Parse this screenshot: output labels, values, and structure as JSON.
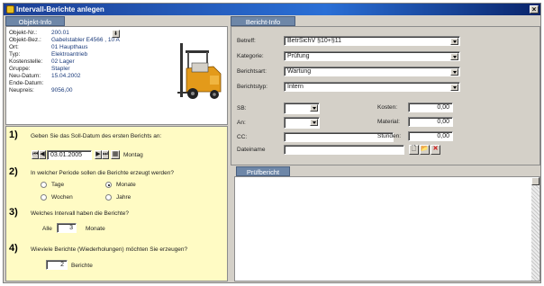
{
  "window": {
    "title": "Intervall-Berichte anlegen",
    "close_label": "×"
  },
  "tabs": {
    "objekt": "Objekt-Info",
    "bericht": "Bericht-Info",
    "pruef": "Prüfbericht"
  },
  "objekt": {
    "rows": [
      {
        "label": "Objekt-Nr.:",
        "value": "200.01"
      },
      {
        "label": "Objekt-Bez.:",
        "value": "Gabelstabler E4566 , 10 A"
      },
      {
        "label": "Ort:",
        "value": "01 Haupthaus"
      },
      {
        "label": "Typ:",
        "value": "Elektroantrieb"
      },
      {
        "label": "Kostenstelle:",
        "value": "02 Lager"
      },
      {
        "label": "Gruppe:",
        "value": "Stapler"
      },
      {
        "label": "Neu-Datum:",
        "value": "15.04.2002"
      },
      {
        "label": "Ende-Datum:",
        "value": ""
      },
      {
        "label": "Neupreis:",
        "value": "9056,00"
      }
    ],
    "image_desc": "forklift-image"
  },
  "wizard": {
    "q1": {
      "num": "1)",
      "text": "Geben Sie das Soll-Datum des ersten Berichts an:",
      "date": "03.01.2005",
      "weekday": "Montag"
    },
    "q2": {
      "num": "2)",
      "text": "In welcher Periode sollen die Berichte erzeugt werden?",
      "options": [
        {
          "label": "Tage",
          "checked": false
        },
        {
          "label": "Monate",
          "checked": true
        },
        {
          "label": "Wochen",
          "checked": false
        },
        {
          "label": "Jahre",
          "checked": false
        }
      ]
    },
    "q3": {
      "num": "3)",
      "text": "Welches Intervall haben die Berichte?",
      "prefix": "Alle",
      "value": "3",
      "unit": "Monate"
    },
    "q4": {
      "num": "4)",
      "text": "Wieviele Berichte (Wiederholungen) möchten Sie erzeugen?",
      "value": "2",
      "unit": "Berichte"
    }
  },
  "bericht": {
    "betreff_label": "Betreff:",
    "betreff_value": "BetrSichV §10+§11",
    "kategorie_label": "Kategorie:",
    "kategorie_value": "Prüfung",
    "berichtsart_label": "Berichtsart:",
    "berichtsart_value": "Wartung",
    "berichtstyp_label": "Berichtstyp:",
    "berichtstyp_value": "Intern",
    "sb_label": "SB:",
    "an_label": "An:",
    "cc_label": "CC:",
    "dateiname_label": "Dateiname",
    "kosten_label": "Kosten:",
    "kosten_value": "0,00",
    "material_label": "Material:",
    "material_value": "0,00",
    "stunden_label": "Stunden:",
    "stunden_value": "0,00"
  }
}
